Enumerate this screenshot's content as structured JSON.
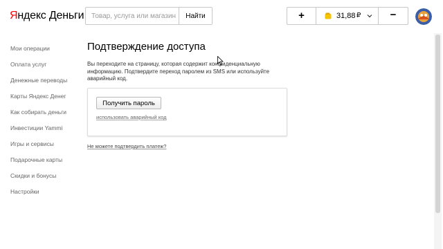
{
  "header": {
    "logo_first_letter": "Я",
    "logo_rest": "ндекс Деньги",
    "search": {
      "placeholder": "Товар, услуга или магазин",
      "value": "",
      "button_label": "Найти"
    },
    "wallet": {
      "add_label": "+",
      "balance": "31,88",
      "currency_symbol": "₽",
      "withdraw_label": "−"
    }
  },
  "sidebar": {
    "items": [
      {
        "label": "Мои операции"
      },
      {
        "label": "Оплата услуг"
      },
      {
        "label": "Денежные переводы"
      },
      {
        "label": "Карты Яндекс Денег"
      },
      {
        "label": "Как собирать деньги"
      },
      {
        "label": "Инвестиции Yammi"
      },
      {
        "label": "Игры и сервисы"
      },
      {
        "label": "Подарочные карты"
      },
      {
        "label": "Скидки и бонусы"
      },
      {
        "label": "Настройки"
      }
    ]
  },
  "main": {
    "title": "Подтверждение доступа",
    "description": "Вы переходите на страницу, которая содержит конфиденциальную информацию. Подтвердите переход паролем из SMS или используйте аварийный код.",
    "get_password_label": "Получить пароль",
    "emergency_code_link": "использовать аварийный код",
    "cannot_confirm_link": "Не можете подтвердить платеж?"
  },
  "colors": {
    "logo_accent": "#ff0000",
    "wallet_icon": "#f5c400",
    "border": "#c8c8c8",
    "muted_text": "#666666"
  },
  "icons": {
    "wallet": "wallet-icon",
    "chevron": "chevron-down-icon",
    "avatar": "avatar",
    "cursor": "cursor-icon"
  }
}
